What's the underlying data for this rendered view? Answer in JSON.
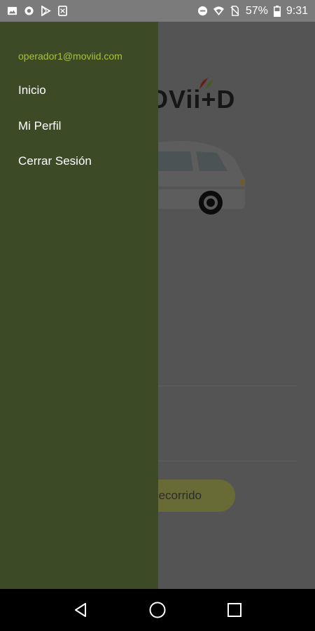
{
  "status_bar": {
    "battery": "57%",
    "time": "9:31",
    "icons_left": [
      "image-icon",
      "circle-icon",
      "play-store-icon",
      "close-box-icon"
    ],
    "icons_right": [
      "do-not-disturb-icon",
      "wifi-icon",
      "no-sim-icon",
      "battery-icon"
    ]
  },
  "drawer": {
    "email": "operador1@moviid.com",
    "items": [
      {
        "label": "Inicio"
      },
      {
        "label": "Mi Perfil"
      },
      {
        "label": "Cerrar Sesión"
      }
    ],
    "background": "#3c4a26",
    "email_color": "#a6c23c"
  },
  "background_screen": {
    "logo": "OVii+D",
    "button_label": "ecorrido"
  },
  "nav_bar": {
    "buttons": [
      "back-icon",
      "home-icon",
      "recents-icon"
    ]
  }
}
